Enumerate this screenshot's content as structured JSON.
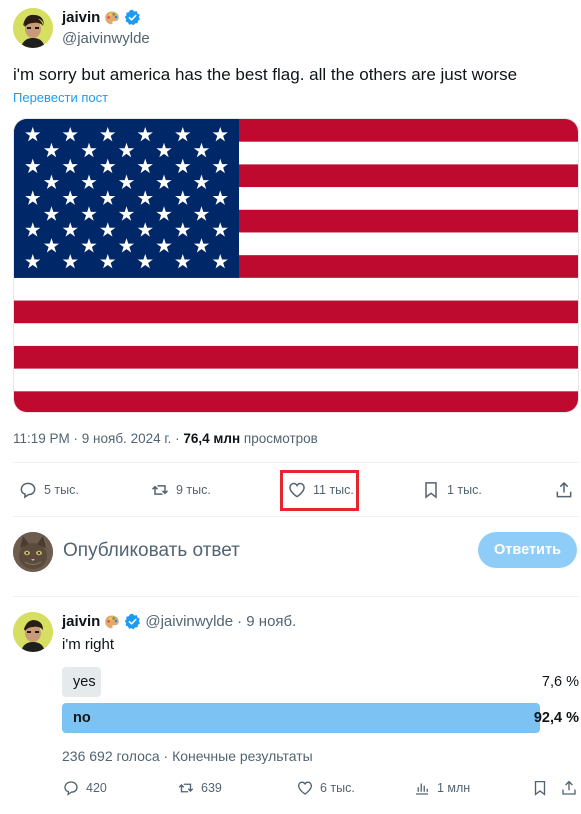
{
  "post": {
    "author": {
      "display_name": "jaivin",
      "handle": "@jaivinwylde",
      "emoji": "palette-emoji",
      "verified": true
    },
    "text": "i'm sorry but america has the best flag. all the others are just worse",
    "translate_label": "Перевести пост",
    "image": "us-flag",
    "meta": {
      "time": "11:19 PM",
      "date": "9 нояб. 2024 г.",
      "views": "76,4 млн",
      "views_label": "просмотров",
      "sep1": " · ",
      "sep2": " · "
    },
    "actions": {
      "replies": "5 тыс.",
      "reposts": "9 тыс.",
      "likes": "11 тыс.",
      "bookmarks": "1 тыс."
    }
  },
  "composer": {
    "placeholder": "Опубликовать ответ",
    "button_label": "Ответить"
  },
  "reply": {
    "display_name": "jaivin",
    "handle": "@jaivinwylde",
    "date": "· 9 нояб.",
    "text": "i'm right",
    "poll": {
      "options": [
        {
          "label": "yes",
          "percent": "7,6 %",
          "value": 7.6
        },
        {
          "label": "no",
          "percent": "92,4 %",
          "value": 92.4
        }
      ],
      "summary": "236 692 голоса · Конечные результаты"
    },
    "actions": {
      "replies": "420",
      "reposts": "639",
      "likes": "6 тыс.",
      "views": "1 млн"
    }
  },
  "colors": {
    "accent": "#1d9bf0",
    "highlight": "#e3272c",
    "flag_red": "#bf0a30",
    "flag_blue": "#002868"
  }
}
